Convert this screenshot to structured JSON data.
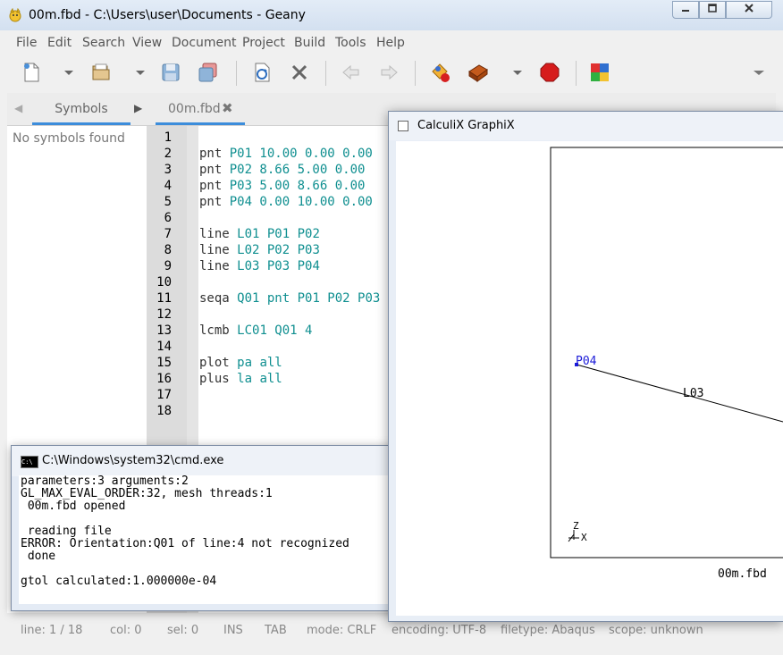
{
  "geany": {
    "title": "00m.fbd - C:\\Users\\user\\Documents - Geany",
    "menu": [
      "File",
      "Edit",
      "Search",
      "View",
      "Document",
      "Project",
      "Build",
      "Tools",
      "Help"
    ],
    "sidebar": {
      "tab_label": "Symbols",
      "empty_message": "No symbols found"
    },
    "editor": {
      "tab_label": "00m.fbd",
      "tab_close": "✖",
      "lines": [
        {
          "num": "1",
          "kw": "",
          "args": ""
        },
        {
          "num": "2",
          "kw": "pnt ",
          "args": "P01 10.00 0.00 0.00"
        },
        {
          "num": "3",
          "kw": "pnt ",
          "args": "P02 8.66 5.00 0.00"
        },
        {
          "num": "4",
          "kw": "pnt ",
          "args": "P03 5.00 8.66 0.00"
        },
        {
          "num": "5",
          "kw": "pnt ",
          "args": "P04 0.00 10.00 0.00"
        },
        {
          "num": "6",
          "kw": "",
          "args": ""
        },
        {
          "num": "7",
          "kw": "line ",
          "args": "L01 P01 P02"
        },
        {
          "num": "8",
          "kw": "line ",
          "args": "L02 P02 P03"
        },
        {
          "num": "9",
          "kw": "line ",
          "args": "L03 P03 P04"
        },
        {
          "num": "10",
          "kw": "",
          "args": ""
        },
        {
          "num": "11",
          "kw": "seqa ",
          "args": "Q01 pnt P01 P02 P03"
        },
        {
          "num": "12",
          "kw": "",
          "args": ""
        },
        {
          "num": "13",
          "kw": "lcmb ",
          "args": "LC01 Q01 4"
        },
        {
          "num": "14",
          "kw": "",
          "args": ""
        },
        {
          "num": "15",
          "kw": "plot ",
          "args": "pa all"
        },
        {
          "num": "16",
          "kw": "plus ",
          "args": "la all"
        },
        {
          "num": "17",
          "kw": "",
          "args": ""
        },
        {
          "num": "18",
          "kw": "",
          "args": ""
        }
      ]
    },
    "status": {
      "line": "line: 1 / 18",
      "col": "col: 0",
      "sel": "sel: 0",
      "ins": "INS",
      "tab": "TAB",
      "mode": "mode: CRLF",
      "encoding": "encoding: UTF-8",
      "filetype": "filetype: Abaqus",
      "scope": "scope: unknown"
    },
    "toolbar_icons": [
      "new-file-icon",
      "dropdown-arrow-icon",
      "open-file-icon",
      "dropdown-arrow-icon",
      "save-icon",
      "save-all-icon",
      "reload-icon",
      "close-file-icon",
      "navigate-back-icon",
      "navigate-forward-icon",
      "compile-icon",
      "build-icon",
      "dropdown-arrow-icon",
      "stop-icon",
      "color-chooser-icon",
      "toolbar-overflow-icon"
    ]
  },
  "cmd": {
    "title": "C:\\Windows\\system32\\cmd.exe",
    "lines": [
      "parameters:3 arguments:2",
      "GL_MAX_EVAL_ORDER:32, mesh threads:1",
      " 00m.fbd opened",
      "",
      " reading file",
      "ERROR: Orientation:Q01 of line:4 not recognized",
      " done",
      "",
      "gtol calculated:1.000000e-04"
    ]
  },
  "graphix": {
    "title": "CalculiX GraphiX",
    "point_label": "P04",
    "line_label": "L03",
    "axis_z": "Z",
    "axis_x": "X",
    "file_label": "00m.fbd"
  },
  "colors": {
    "accent": "#3c8ddb",
    "code_args": "#0f8f90",
    "point_blue": "#1a1ad8"
  }
}
